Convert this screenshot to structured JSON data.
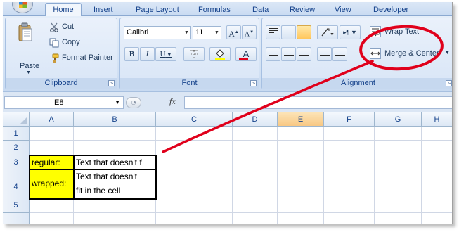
{
  "tabs": [
    "Home",
    "Insert",
    "Page Layout",
    "Formulas",
    "Data",
    "Review",
    "View",
    "Developer"
  ],
  "clipboard": {
    "paste": "Paste",
    "cut": "Cut",
    "copy": "Copy",
    "format_painter": "Format Painter",
    "label": "Clipboard"
  },
  "font": {
    "name": "Calibri",
    "size": "11",
    "grow": "A",
    "shrink": "A",
    "bold": "B",
    "italic": "I",
    "underline": "U",
    "font_color": "A",
    "label": "Font"
  },
  "alignment": {
    "wrap_text": "Wrap Text",
    "merge_center": "Merge & Center",
    "label": "Alignment"
  },
  "formula_bar": {
    "name_box": "E8",
    "fx": "fx"
  },
  "columns": [
    "A",
    "B",
    "C",
    "D",
    "E",
    "F",
    "G",
    "H"
  ],
  "rows": [
    "1",
    "2",
    "3",
    "4",
    "5"
  ],
  "cells": {
    "a3": "regular:",
    "b3": "Text that doesn't f",
    "a4": "wrapped:",
    "b4_line1": "Text that doesn't",
    "b4_line2": "fit in the cell"
  },
  "colors": {
    "highlight": "#ffff00",
    "annotation": "#e0001b",
    "selected_header": "#f8c884"
  }
}
